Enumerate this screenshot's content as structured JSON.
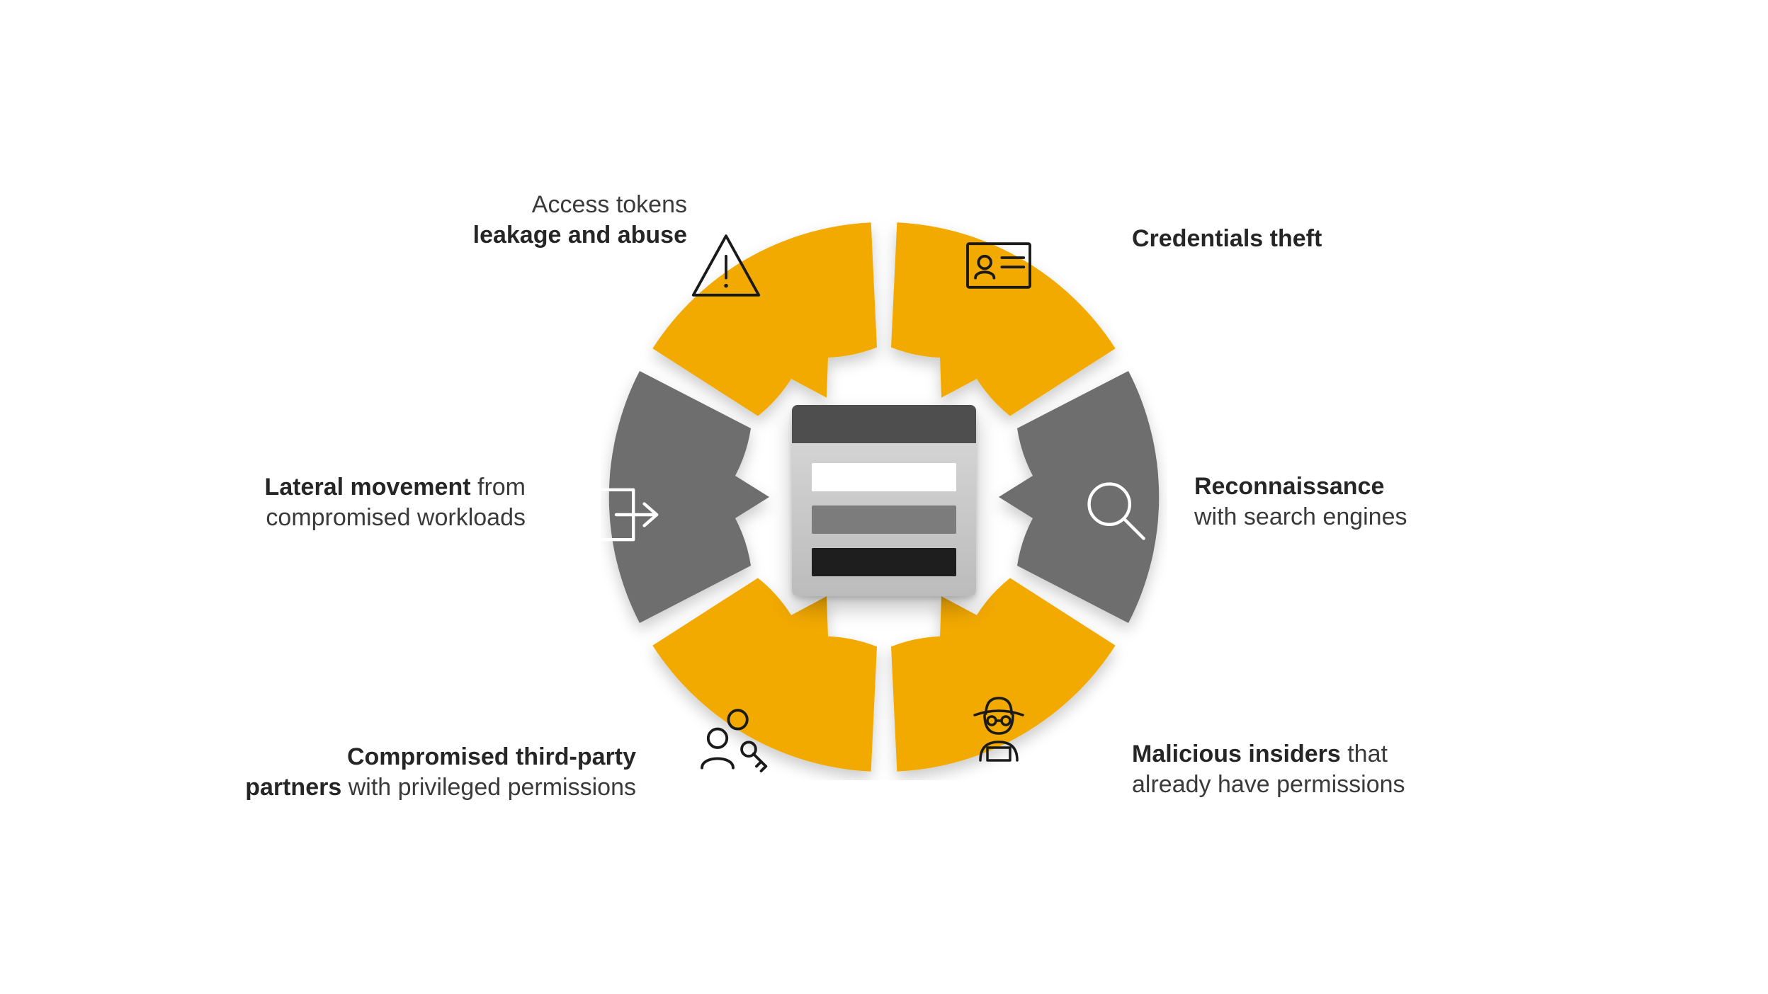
{
  "colors": {
    "yellow": "#F2A900",
    "gray": "#6E6E6E"
  },
  "center": {
    "kind": "application-window"
  },
  "segments": [
    {
      "id": "access-tokens",
      "position": "top-left",
      "color": "yellow",
      "icon": "warning-triangle-icon",
      "label_light": "Access tokens",
      "label_bold": "leakage and abuse"
    },
    {
      "id": "credentials-theft",
      "position": "top-right",
      "color": "yellow",
      "icon": "id-card-icon",
      "label_bold": "Credentials theft",
      "label_light": ""
    },
    {
      "id": "reconnaissance",
      "position": "mid-right",
      "color": "gray",
      "icon": "magnifier-icon",
      "label_bold": "Reconnaissance",
      "label_light": "with search engines"
    },
    {
      "id": "malicious-insiders",
      "position": "bottom-right",
      "color": "yellow",
      "icon": "insider-spy-icon",
      "label_bold": "Malicious insiders",
      "label_light": "that already have permissions"
    },
    {
      "id": "compromised-partners",
      "position": "bottom-left",
      "color": "yellow",
      "icon": "people-key-icon",
      "label_bold": "Compromised third-party partners",
      "label_light": "with privileged permissions"
    },
    {
      "id": "lateral-movement",
      "position": "mid-left",
      "color": "gray",
      "icon": "exit-arrow-icon",
      "label_bold": "Lateral movement",
      "label_light": "from compromised workloads"
    }
  ],
  "labels": {
    "top_left": {
      "line1_light": "Access tokens",
      "line2_bold": "leakage and abuse"
    },
    "top_right": {
      "line1_bold": "Credentials theft"
    },
    "mid_left": {
      "line1_bold": "Lateral movement",
      "line1_light_after": " from",
      "line2_light": "compromised workloads"
    },
    "mid_right": {
      "line1_bold": "Reconnaissance",
      "line2_light": "with search engines"
    },
    "bot_left": {
      "line1_bold": "Compromised third-party",
      "line2_bold": "partners",
      "line2_light_after": " with privileged permissions"
    },
    "bot_right": {
      "line1_bold": "Malicious insiders",
      "line1_light_after": " that",
      "line2_light": "already have permissions"
    }
  }
}
